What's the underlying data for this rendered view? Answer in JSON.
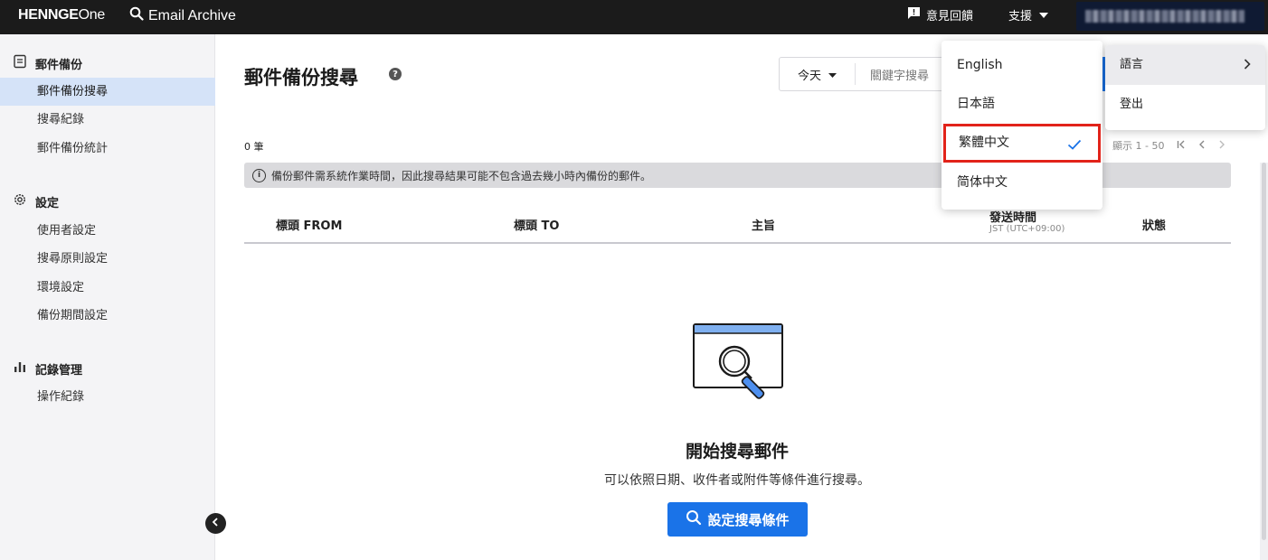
{
  "topbar": {
    "brand_part1": "HENNGE",
    "brand_part2": "One",
    "app_name": "Email Archive",
    "feedback_label": "意見回饋",
    "support_label": "支援"
  },
  "sidebar": {
    "sections": [
      {
        "title": "郵件備份",
        "items": [
          "郵件備份搜尋",
          "搜尋紀錄",
          "郵件備份統計"
        ]
      },
      {
        "title": "設定",
        "items": [
          "使用者設定",
          "搜尋原則設定",
          "環境設定",
          "備份期間設定"
        ]
      },
      {
        "title": "記錄管理",
        "items": [
          "操作紀錄"
        ]
      }
    ],
    "active_item": "郵件備份搜尋"
  },
  "main": {
    "page_title": "郵件備份搜尋",
    "search": {
      "range_value": "今天",
      "keyword_placeholder": "關鍵字搜尋"
    },
    "result_count": "0 筆",
    "pager_label": "顯示 1 - 50",
    "notice": "備份郵件需系統作業時間，因此搜尋結果可能不包含過去幾小時內備份的郵件。",
    "table_headers": {
      "from": "標頭 FROM",
      "to": "標頭 TO",
      "subject": "主旨",
      "sent_time": "發送時間",
      "sent_time_sub": "JST (UTC+09:00)",
      "status": "狀態"
    },
    "empty_state": {
      "title": "開始搜尋郵件",
      "description": "可以依照日期、收件者或附件等條件進行搜尋。",
      "button_label": "設定搜尋條件"
    }
  },
  "language_menu": {
    "items": [
      "English",
      "日本語",
      "繁體中文",
      "简体中文"
    ],
    "selected": "繁體中文"
  },
  "user_menu": {
    "language_label": "語言",
    "logout_label": "登出"
  },
  "colors": {
    "topbar_bg": "#1b1b1b",
    "accent": "#1a73e8",
    "highlight_box": "#e2231a",
    "active_nav_bg": "#d5e3f8"
  }
}
